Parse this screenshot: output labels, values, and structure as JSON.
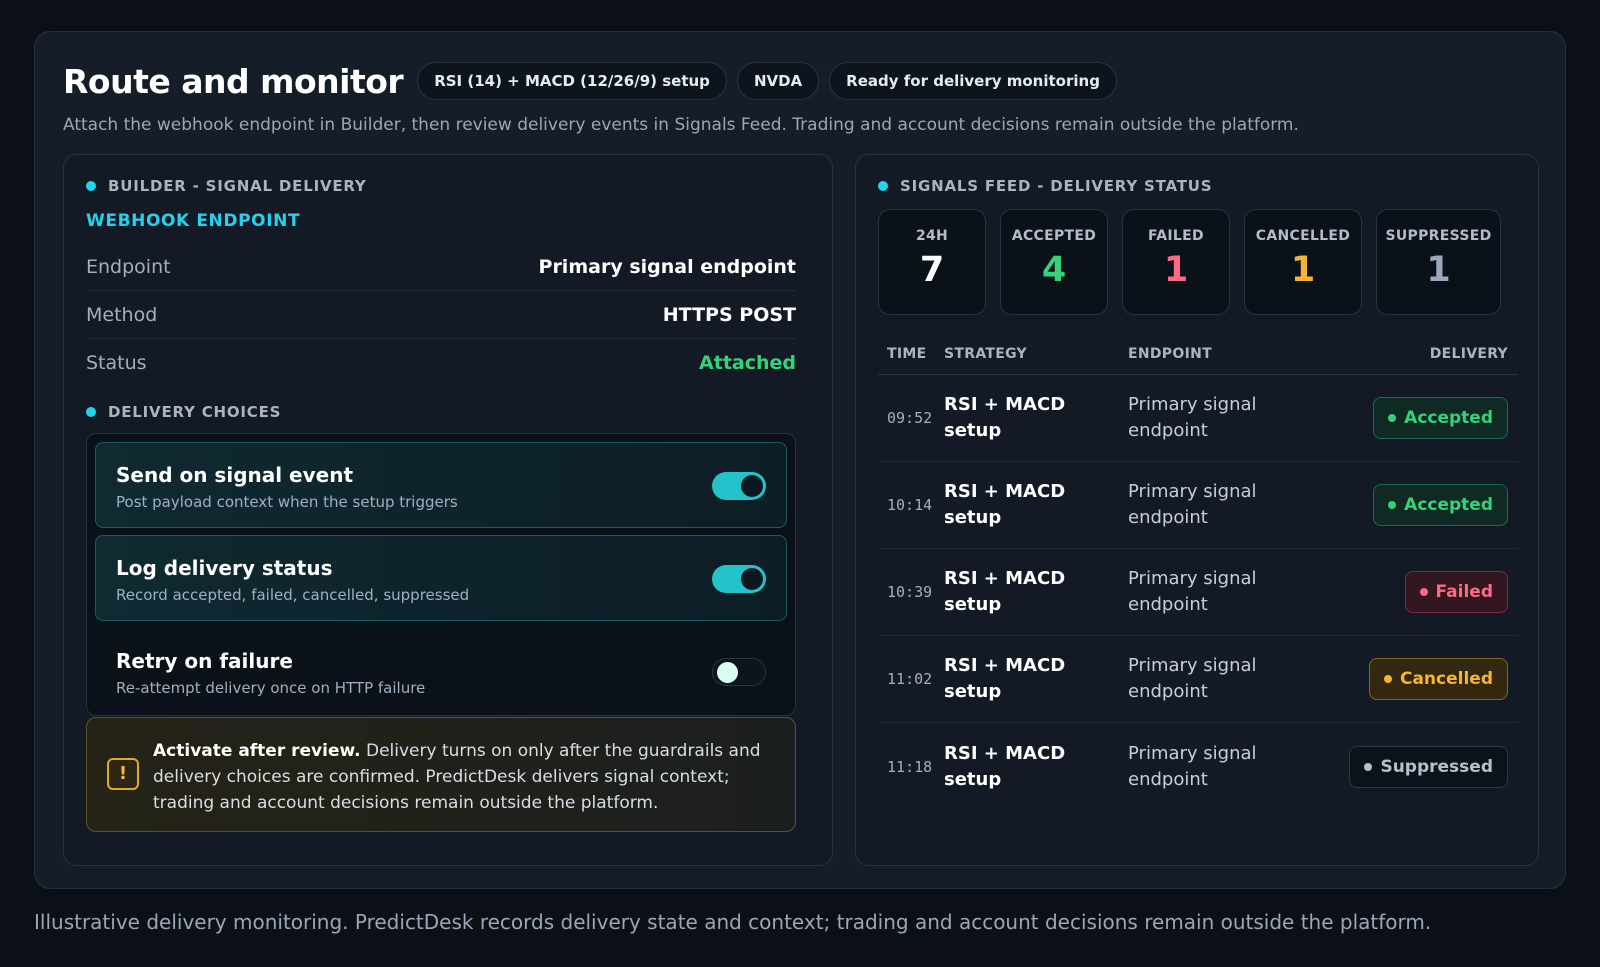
{
  "header": {
    "title": "Route and monitor",
    "pills": [
      "RSI (14) + MACD (12/26/9) setup",
      "NVDA",
      "Ready for delivery monitoring"
    ],
    "subtitle": "Attach the webhook endpoint in Builder, then review delivery events in Signals Feed. Trading and account decisions remain outside the platform."
  },
  "builder": {
    "section_title": "BUILDER - SIGNAL DELIVERY",
    "webhook_title": "WEBHOOK ENDPOINT",
    "rows": [
      {
        "key": "Endpoint",
        "value": "Primary signal endpoint"
      },
      {
        "key": "Method",
        "value": "HTTPS POST"
      },
      {
        "key": "Status",
        "value": "Attached"
      }
    ],
    "choices_title": "DELIVERY CHOICES",
    "choices": [
      {
        "title": "Send on signal event",
        "desc": "Post payload context when the setup triggers",
        "enabled": true
      },
      {
        "title": "Log delivery status",
        "desc": "Record accepted, failed, cancelled, suppressed",
        "enabled": true
      },
      {
        "title": "Retry on failure",
        "desc": "Re-attempt delivery once on HTTP failure",
        "enabled": false
      }
    ],
    "notice": {
      "icon": "!",
      "bold": "Activate after review.",
      "text": " Delivery turns on only after the guardrails and delivery choices are confirmed. PredictDesk delivers signal context; trading and account decisions remain outside the platform."
    }
  },
  "feed": {
    "section_title": "SIGNALS FEED - DELIVERY STATUS",
    "stats": [
      {
        "label": "24H",
        "value": "7",
        "color": "#ffffff"
      },
      {
        "label": "ACCEPTED",
        "value": "4",
        "color": "#34d27b"
      },
      {
        "label": "FAILED",
        "value": "1",
        "color": "#fb6b85"
      },
      {
        "label": "CANCELLED",
        "value": "1",
        "color": "#f5b431"
      },
      {
        "label": "SUPPRESSED",
        "value": "1",
        "color": "#9aa7bd"
      }
    ],
    "columns": {
      "time": "TIME",
      "strategy": "STRATEGY",
      "endpoint": "ENDPOINT",
      "delivery": "DELIVERY"
    },
    "rows": [
      {
        "time": "09:52",
        "strategy": "RSI + MACD setup",
        "endpoint": "Primary signal endpoint",
        "status": "Accepted"
      },
      {
        "time": "10:14",
        "strategy": "RSI + MACD setup",
        "endpoint": "Primary signal endpoint",
        "status": "Accepted"
      },
      {
        "time": "10:39",
        "strategy": "RSI + MACD setup",
        "endpoint": "Primary signal endpoint",
        "status": "Failed"
      },
      {
        "time": "11:02",
        "strategy": "RSI + MACD setup",
        "endpoint": "Primary signal endpoint",
        "status": "Cancelled"
      },
      {
        "time": "11:18",
        "strategy": "RSI + MACD setup",
        "endpoint": "Primary signal endpoint",
        "status": "Suppressed"
      }
    ],
    "status_colors": {
      "Accepted": {
        "fg": "#34d27b",
        "bg": "#0f2a22",
        "border": "#1f6a4c"
      },
      "Failed": {
        "fg": "#fb6b85",
        "bg": "#33161f",
        "border": "#7a2e40"
      },
      "Cancelled": {
        "fg": "#f5b431",
        "bg": "#33280f",
        "border": "#85671f"
      },
      "Suppressed": {
        "fg": "#b5c0cf",
        "bg": "#0c121a",
        "border": "#2c3848"
      }
    }
  },
  "footer": "Illustrative delivery monitoring. PredictDesk records delivery state and context; trading and account decisions remain outside the platform."
}
